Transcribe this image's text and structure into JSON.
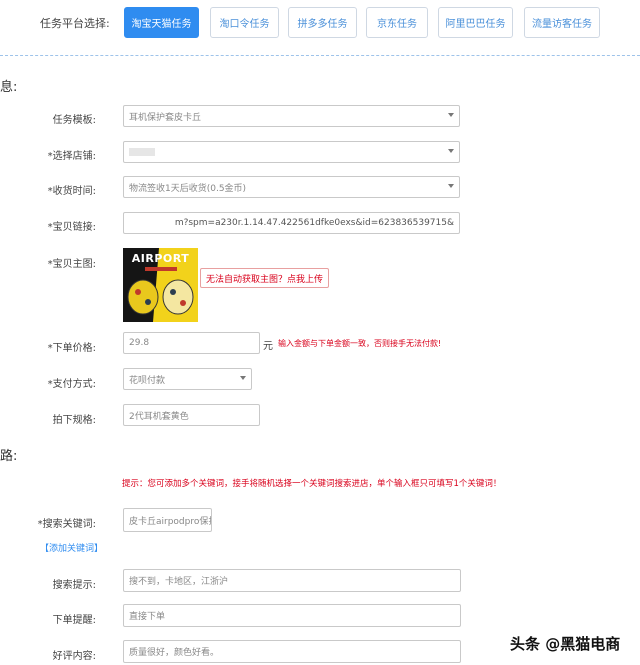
{
  "platform": {
    "label": "任务平台选择:",
    "tabs": [
      "淘宝天猫任务",
      "淘口令任务",
      "拼多多任务",
      "京东任务",
      "阿里巴巴任务",
      "流量访客任务"
    ],
    "active_index": 0
  },
  "section_info": {
    "title": "息:"
  },
  "form": {
    "template": {
      "label": "任务模板:",
      "value": "耳机保护套皮卡丘"
    },
    "store": {
      "label": "*选择店铺:",
      "value": ""
    },
    "receive_time": {
      "label": "*收货时间:",
      "value": "物流签收1天后收货(0.5金币)"
    },
    "link": {
      "label": "*宝贝链接:",
      "value": "m?spm=a230r.1.14.47.422561dfke0exs&id=623836539715&"
    },
    "main_image": {
      "label": "*宝贝主图:",
      "upload_label": "无法自动获取主图？点我上传",
      "image_text": "AIRPORT"
    },
    "price": {
      "label": "*下单价格:",
      "value": "29.8",
      "unit": "元",
      "warning": "输入金额与下单金额一致，否则接手无法付款!"
    },
    "payment": {
      "label": "*支付方式:",
      "value": "花呗付款"
    },
    "spec": {
      "label": "拍下规格:",
      "value": "2代耳机套黄色"
    }
  },
  "section_route": {
    "title": "路:"
  },
  "route": {
    "tip": "提示：您可添加多个关键词，接手将随机选择一个关键词搜索进店，单个输入框只可填写1个关键词！",
    "keyword": {
      "label": "*搜索关键词:",
      "value": "皮卡丘airpodpro保护壳"
    },
    "add_keyword": "【添加关键词】",
    "search_hint": {
      "label": "搜索提示:",
      "placeholder": "搜不到，卡地区，江浙沪"
    },
    "order_reminder": {
      "label": "下单提醒:",
      "placeholder": "直接下单"
    },
    "review": {
      "label": "好评内容:",
      "placeholder": "质量很好，颜色好看。"
    }
  },
  "watermark": "头条 @黑猫电商",
  "colors": {
    "primary": "#2f8cf0",
    "warning": "#d9001b"
  }
}
